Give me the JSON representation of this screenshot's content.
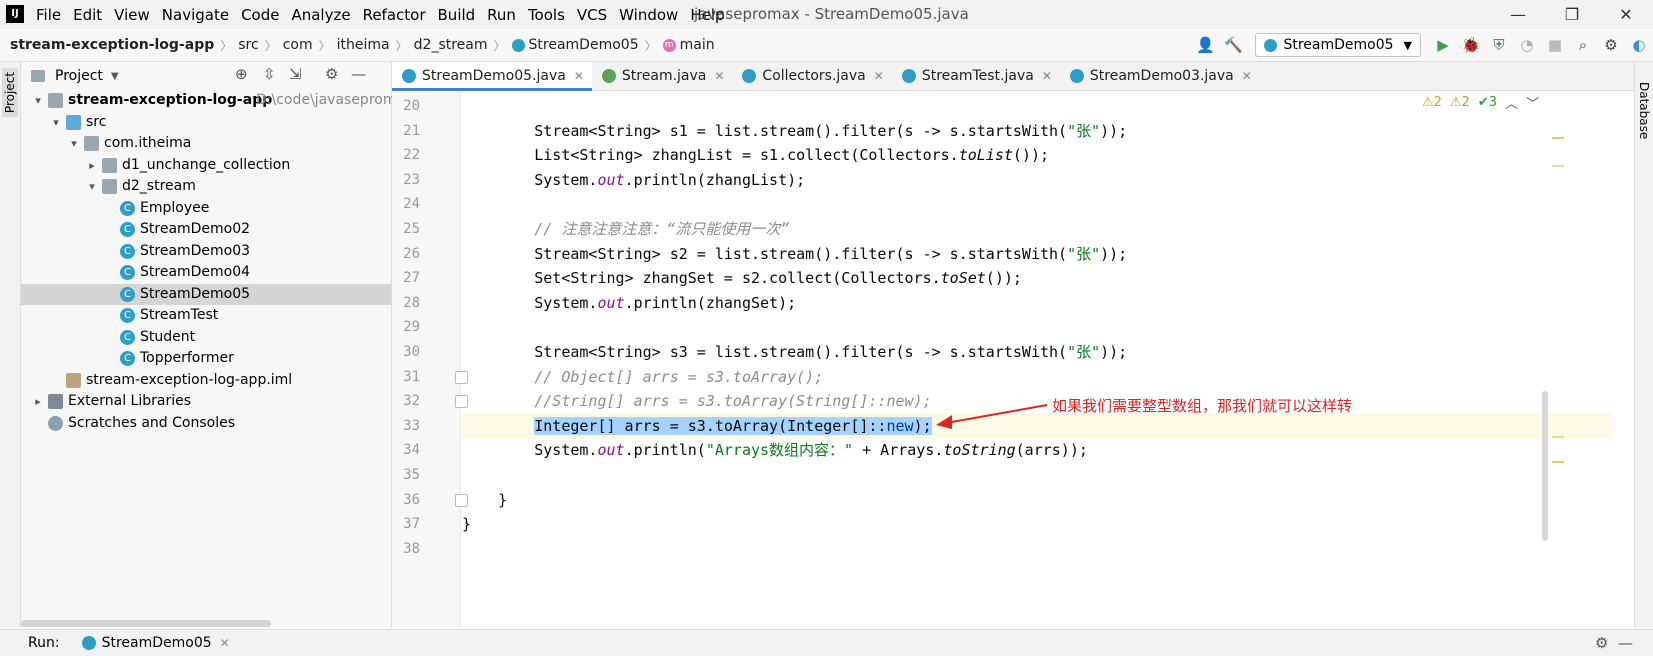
{
  "app": {
    "logo": "IJ",
    "menu": [
      "File",
      "Edit",
      "View",
      "Navigate",
      "Code",
      "Analyze",
      "Refactor",
      "Build",
      "Run",
      "Tools",
      "VCS",
      "Window",
      "Help"
    ],
    "title": "javasepromax - StreamDemo05.java",
    "window_buttons": {
      "minimize": "—",
      "restore": "❐",
      "close": "✕"
    }
  },
  "navbar": {
    "crumbs": [
      "stream-exception-log-app",
      "src",
      "com",
      "itheima",
      "d2_stream",
      "StreamDemo05",
      "main"
    ],
    "run_config": "StreamDemo05",
    "method_icon": "m"
  },
  "project": {
    "title": "Project",
    "tree": [
      {
        "label": "stream-exception-log-app",
        "hint": "D:\\code\\javasepromax\\",
        "level": 0,
        "arrow": "▾",
        "icon": "folder",
        "bold": true
      },
      {
        "label": "src",
        "level": 1,
        "arrow": "▾",
        "icon": "folderblue"
      },
      {
        "label": "com.itheima",
        "level": 2,
        "arrow": "▾",
        "icon": "folder"
      },
      {
        "label": "d1_unchange_collection",
        "level": 3,
        "arrow": "▸",
        "icon": "folder"
      },
      {
        "label": "d2_stream",
        "level": 3,
        "arrow": "▾",
        "icon": "folder"
      },
      {
        "label": "Employee",
        "level": 4,
        "arrow": "",
        "icon": "cls"
      },
      {
        "label": "StreamDemo02",
        "level": 4,
        "arrow": "",
        "icon": "cls"
      },
      {
        "label": "StreamDemo03",
        "level": 4,
        "arrow": "",
        "icon": "cls"
      },
      {
        "label": "StreamDemo04",
        "level": 4,
        "arrow": "",
        "icon": "cls"
      },
      {
        "label": "StreamDemo05",
        "level": 4,
        "arrow": "",
        "icon": "cls",
        "selected": true
      },
      {
        "label": "StreamTest",
        "level": 4,
        "arrow": "",
        "icon": "cls"
      },
      {
        "label": "Student",
        "level": 4,
        "arrow": "",
        "icon": "cls"
      },
      {
        "label": "Topperformer",
        "level": 4,
        "arrow": "",
        "icon": "cls"
      },
      {
        "label": "stream-exception-log-app.iml",
        "level": 1,
        "arrow": "",
        "icon": "file"
      },
      {
        "label": "External Libraries",
        "level": 0,
        "arrow": "▸",
        "icon": "lib"
      },
      {
        "label": "Scratches and Consoles",
        "level": 0,
        "arrow": "",
        "icon": "scr"
      }
    ]
  },
  "tabs": [
    {
      "label": "StreamDemo05.java",
      "active": true,
      "icon": "cls"
    },
    {
      "label": "Stream.java",
      "active": false,
      "icon": "iface"
    },
    {
      "label": "Collectors.java",
      "active": false,
      "icon": "cls"
    },
    {
      "label": "StreamTest.java",
      "active": false,
      "icon": "cls"
    },
    {
      "label": "StreamDemo03.java",
      "active": false,
      "icon": "cls"
    }
  ],
  "indicators": {
    "warn1": "⚠2",
    "warn2": "⚠2",
    "ok": "✔3"
  },
  "code": {
    "lines": [
      {
        "n": "20",
        "html": ""
      },
      {
        "n": "21",
        "html": "        Stream&lt;String&gt; s1 = list.stream().filter(s -&gt; s.startsWith(<span class=\"str\">\"张\"</span>));"
      },
      {
        "n": "22",
        "html": "        List&lt;String&gt; zhangList = s1.collect(Collectors.<span class=\"it\">toList</span>());"
      },
      {
        "n": "23",
        "html": "        System.<span class=\"static\">out</span>.println(zhangList);"
      },
      {
        "n": "24",
        "html": ""
      },
      {
        "n": "25",
        "html": "        <span class=\"cmt\">// 注意注意注意：“流只能使用一次”</span>"
      },
      {
        "n": "26",
        "html": "        Stream&lt;String&gt; s2 = list.stream().filter(s -&gt; s.startsWith(<span class=\"str\">\"张\"</span>));"
      },
      {
        "n": "27",
        "html": "        Set&lt;String&gt; zhangSet = s2.collect(Collectors.<span class=\"it\">toSet</span>());"
      },
      {
        "n": "28",
        "html": "        System.<span class=\"static\">out</span>.println(zhangSet);"
      },
      {
        "n": "29",
        "html": ""
      },
      {
        "n": "30",
        "html": "        Stream&lt;String&gt; s3 = list.stream().filter(s -&gt; s.startsWith(<span class=\"str\">\"张\"</span>));"
      },
      {
        "n": "31",
        "html": "        <span class=\"cmt\">// Object[] arrs = s3.toArray();</span>"
      },
      {
        "n": "32",
        "html": "        <span class=\"cmt\">//String[] arrs = s3.toArray(String[]::new);</span>"
      },
      {
        "n": "33",
        "html": "        <span class=\"sel\">Integer[] arrs = s3.toArray(Integer[]::<span class=\"kw\">new</span>);</span>",
        "current": true
      },
      {
        "n": "34",
        "html": "        System.<span class=\"static\">out</span>.println(<span class=\"str\">\"Arrays数组内容：\"</span> + Arrays.<span class=\"it\">toString</span>(arrs));"
      },
      {
        "n": "35",
        "html": ""
      },
      {
        "n": "36",
        "html": "    }"
      },
      {
        "n": "37",
        "html": "}"
      },
      {
        "n": "38",
        "html": ""
      }
    ]
  },
  "annotation": "如果我们需要整型数组，那我们就可以这样转",
  "status": {
    "run_label": "Run:",
    "run_tab": "StreamDemo05"
  },
  "stripes": {
    "left": "Project",
    "right": "Database"
  },
  "colors": {
    "accent": "#4083c9",
    "annotation": "#e02424",
    "selection": "#a6d2ff"
  }
}
